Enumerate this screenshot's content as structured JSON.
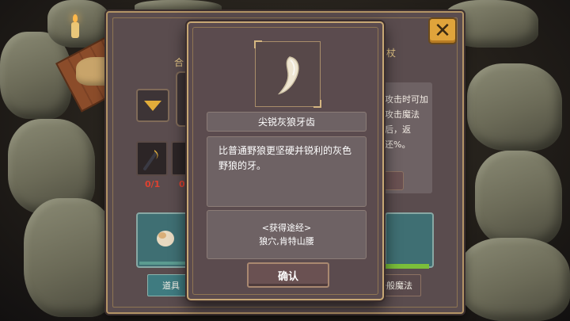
{
  "item_dialog": {
    "item_name": "尖锐灰狼牙齿",
    "description": "比普通野狼更坚硬并锐利的灰色野狼的牙。",
    "source_title": "<获得途经>",
    "source_location": "狼穴,肯特山腰",
    "confirm_label": "确认"
  },
  "crafting_panel": {
    "title_left": "合",
    "title_right": "杖",
    "right_description": "攻击时可加攻击魔法后，返还%。",
    "material_counts": [
      "0/1",
      "0"
    ],
    "tab_left_label": "道具",
    "tab_right_label": "一般魔法",
    "close_icon": "close-icon"
  },
  "colors": {
    "accent_gold": "#e0a43b",
    "teal_tab": "#3f7b80",
    "count_red": "#e0412f"
  }
}
